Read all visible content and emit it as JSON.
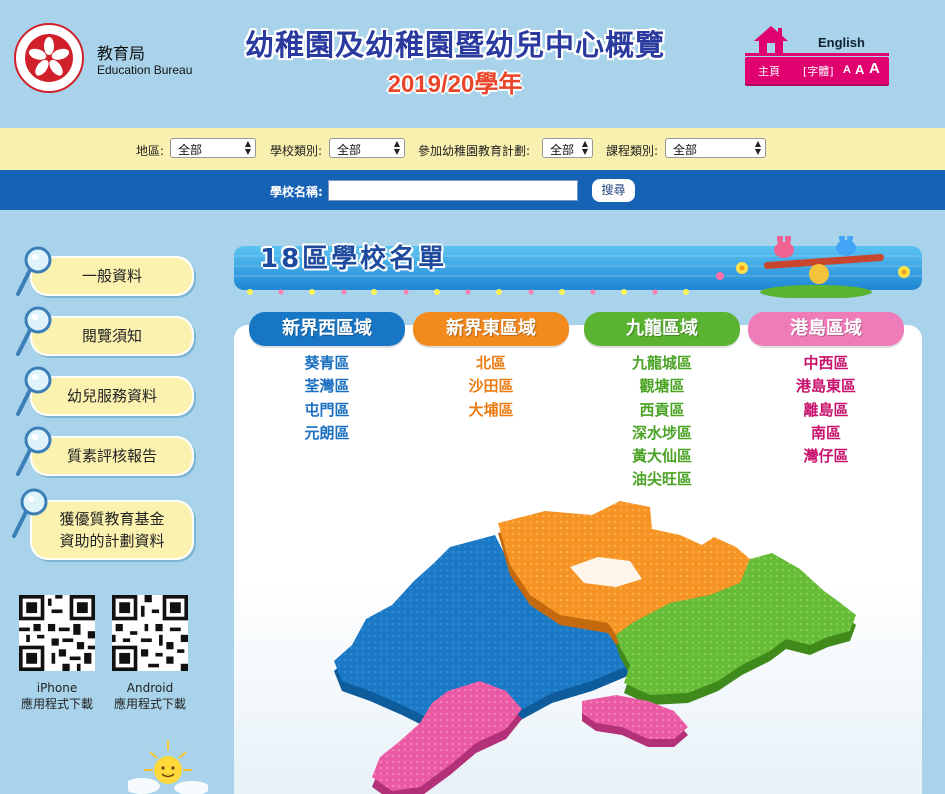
{
  "header": {
    "bureau_zh": "教育局",
    "bureau_en": "Education Bureau",
    "title": "幼稚園及幼稚園暨幼兒中心概覽",
    "year": "2019/20學年",
    "english_link": "English",
    "home_link": "主頁",
    "font_size_label": "[字體]",
    "font_small": "A",
    "font_medium": "A",
    "font_large": "A"
  },
  "filters": [
    {
      "label": "地區:",
      "selected": "全部"
    },
    {
      "label": "學校類別:",
      "selected": "全部"
    },
    {
      "label": "參加幼稚園教育計劃:",
      "selected": "全部"
    },
    {
      "label": "課程類別:",
      "selected": "全部"
    }
  ],
  "search": {
    "label": "學校名稱:",
    "value": "",
    "button": "搜尋"
  },
  "sidebar": {
    "items": [
      {
        "label": "一般資料"
      },
      {
        "label": "閱覽須知"
      },
      {
        "label": "幼兒服務資料"
      },
      {
        "label": "質素評核報告"
      },
      {
        "label_line1": "獲優質教育基金",
        "label_line2": "資助的計劃資料"
      }
    ],
    "apps": [
      {
        "line1": "iPhone",
        "line2": "應用程式下載"
      },
      {
        "line1": "Android",
        "line2": "應用程式下載"
      }
    ]
  },
  "main": {
    "list_title": "18區學校名單",
    "regions": [
      {
        "name": "新界西區域",
        "color": "#1877c5",
        "districts": [
          "葵青區",
          "荃灣區",
          "屯門區",
          "元朗區"
        ]
      },
      {
        "name": "新界東區域",
        "color": "#f28a1e",
        "districts": [
          "北區",
          "沙田區",
          "大埔區"
        ]
      },
      {
        "name": "九龍區域",
        "color": "#5bb431",
        "districts": [
          "九龍城區",
          "觀塘區",
          "西貢區",
          "深水埗區",
          "黃大仙區",
          "油尖旺區"
        ]
      },
      {
        "name": "港島區域",
        "color": "#e4489a",
        "districts": [
          "中西區",
          "港島東區",
          "離島區",
          "南區",
          "灣仔區"
        ]
      }
    ]
  },
  "colors": {
    "background": "#a9d3ea",
    "filter_bar": "#f8f0ae",
    "search_bar": "#1663b5",
    "accent_pink": "#e0006e",
    "title_blue": "#2a3a9e",
    "year_orange": "#e8452a"
  },
  "icons": [
    "bauhinia-emblem-icon",
    "home-icon",
    "magnifier-icon",
    "qr-code-icon",
    "sun-icon"
  ]
}
